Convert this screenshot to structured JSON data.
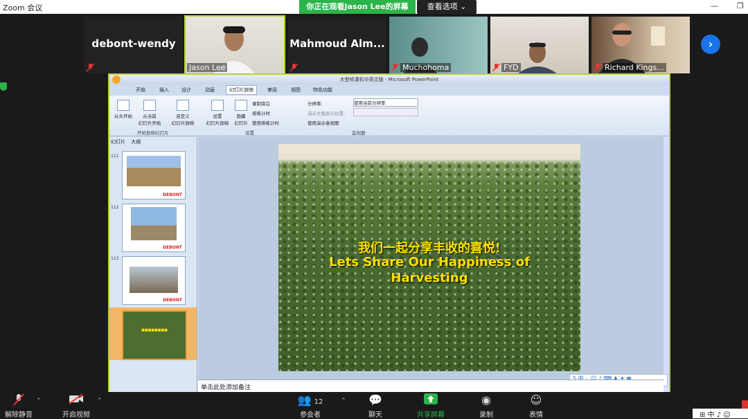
{
  "window": {
    "title": "Zoom 会议",
    "minimize": "—",
    "restore": "❐"
  },
  "banner": {
    "viewing_text": "你正在观看Jason Lee的屏幕",
    "view_options": "查看选项 ⌄"
  },
  "participants": [
    {
      "name": "debont-wendy",
      "video": false
    },
    {
      "name": "Jason Lee",
      "video": true,
      "active": true
    },
    {
      "name": "Mahmoud  Alm...",
      "video": false
    },
    {
      "name": "Muchohoma",
      "video": true
    },
    {
      "name": "FYD",
      "video": true
    },
    {
      "name": "Richard Kings...",
      "video": true
    }
  ],
  "ppt": {
    "window_title": "大型喷灌机中英文版 - Microsoft PowerPoint",
    "tabs": [
      "开始",
      "插入",
      "设计",
      "动画",
      "幻灯片放映",
      "审阅",
      "视图",
      "特色功能"
    ],
    "selected_tab": "幻灯片放映",
    "ribbon": {
      "from_start": "从头开始",
      "from_current": "从当前\n幻灯片开始",
      "custom": "自定义\n幻灯片放映",
      "group_start": "开始放映幻灯片",
      "setup": "设置\n幻灯片放映",
      "hide": "隐藏\n幻灯片",
      "record": "录制旁白",
      "rehearse": "排练计时",
      "use_timing": "使用排练计时",
      "group_setup": "设置",
      "resolution_label": "分辨率:",
      "resolution_value": "使用当前分辨率",
      "show_on": "演示文稿显示位置:",
      "presenter_view": "使用演示者视图",
      "group_monitor": "监视器"
    },
    "pane_tabs": [
      "幻灯片",
      "大纲"
    ],
    "thumbnails": [
      {
        "num": "111",
        "brand": "DEBONT"
      },
      {
        "num": "112",
        "brand": "DEBONT"
      },
      {
        "num": "113",
        "brand": "DEBONT"
      },
      {
        "num": "114",
        "brand": ""
      }
    ],
    "slide": {
      "line1": "我们一起分享丰收的喜悦!",
      "line2": "Lets Share Our Happiness of",
      "line3": "Harvesting"
    },
    "notes_placeholder": "单击此处添加备注",
    "ime": "S 中 ·, ☺ ♪ ⌨ ♟ ✦ ▦"
  },
  "toolbar": {
    "unmute": "解除静音",
    "start_video": "开启视频",
    "participants": "参会者",
    "participant_count": "12",
    "chat": "聊天",
    "share_screen": "共享屏幕",
    "record": "录制",
    "reactions": "表情"
  },
  "tray": "⊞ 中 ♪ ☺"
}
